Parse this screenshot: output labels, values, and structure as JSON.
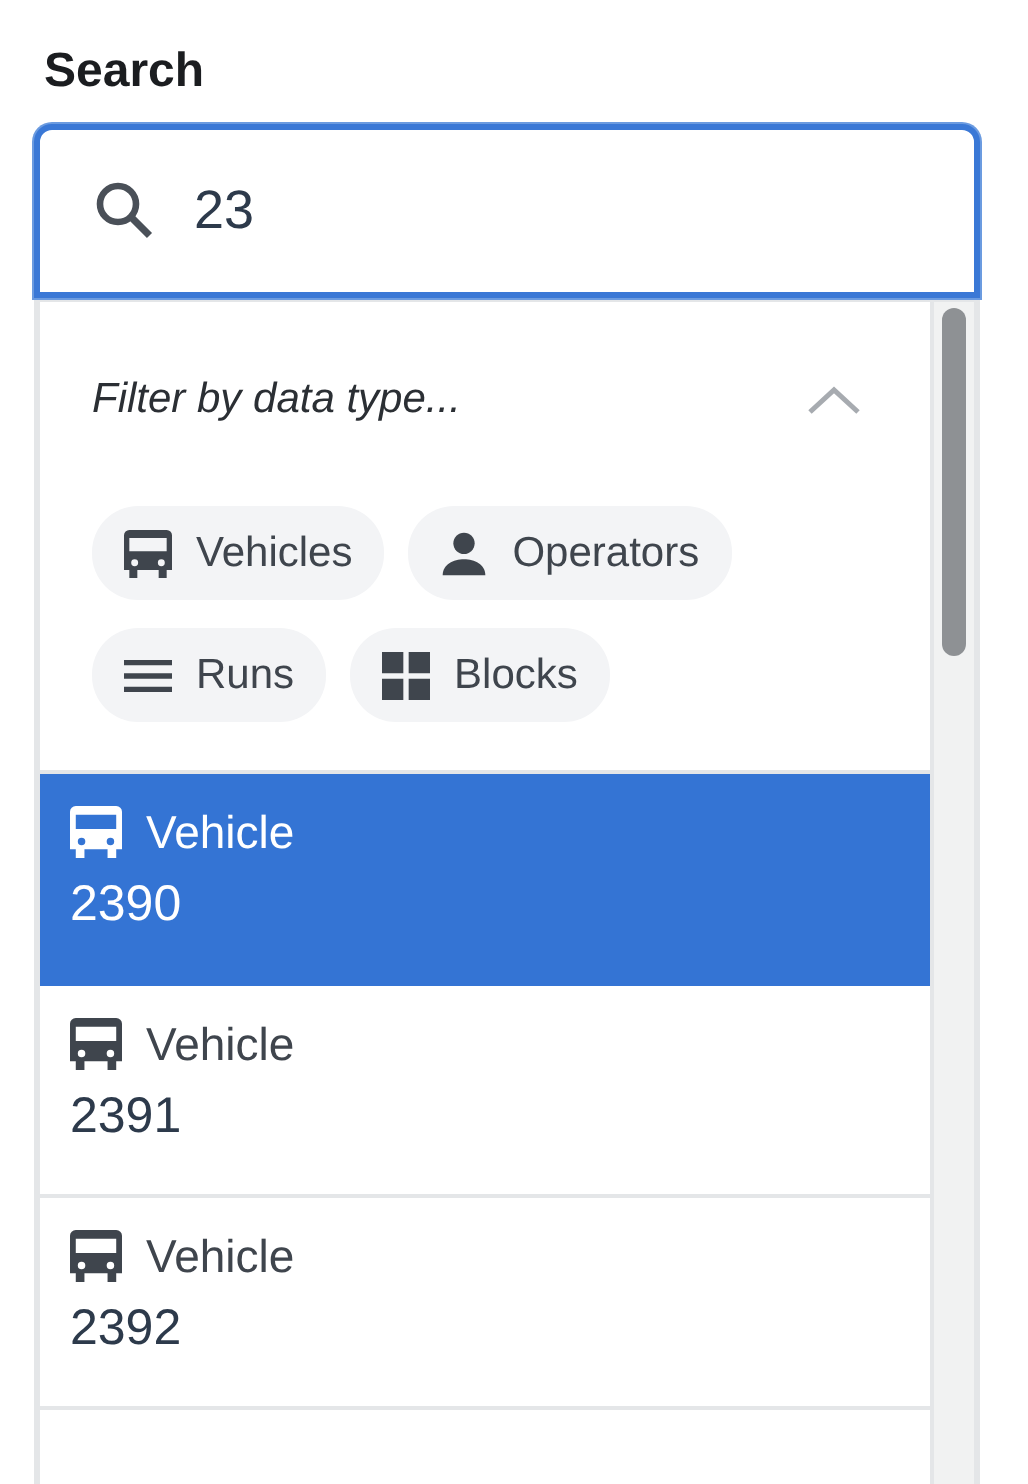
{
  "search": {
    "label": "Search",
    "value": "23"
  },
  "filter": {
    "title": "Filter by data type...",
    "expanded": true,
    "chips": [
      {
        "kind": "vehicle",
        "label": "Vehicles",
        "selected": false
      },
      {
        "kind": "operator",
        "label": "Operators",
        "selected": false
      },
      {
        "kind": "run",
        "label": "Runs",
        "selected": false
      },
      {
        "kind": "block",
        "label": "Blocks",
        "selected": false
      }
    ]
  },
  "results": [
    {
      "kind": "vehicle",
      "type": "Vehicle",
      "id": "2390",
      "selected": true
    },
    {
      "kind": "vehicle",
      "type": "Vehicle",
      "id": "2391",
      "selected": false
    },
    {
      "kind": "vehicle",
      "type": "Vehicle",
      "id": "2392",
      "selected": false
    }
  ]
}
